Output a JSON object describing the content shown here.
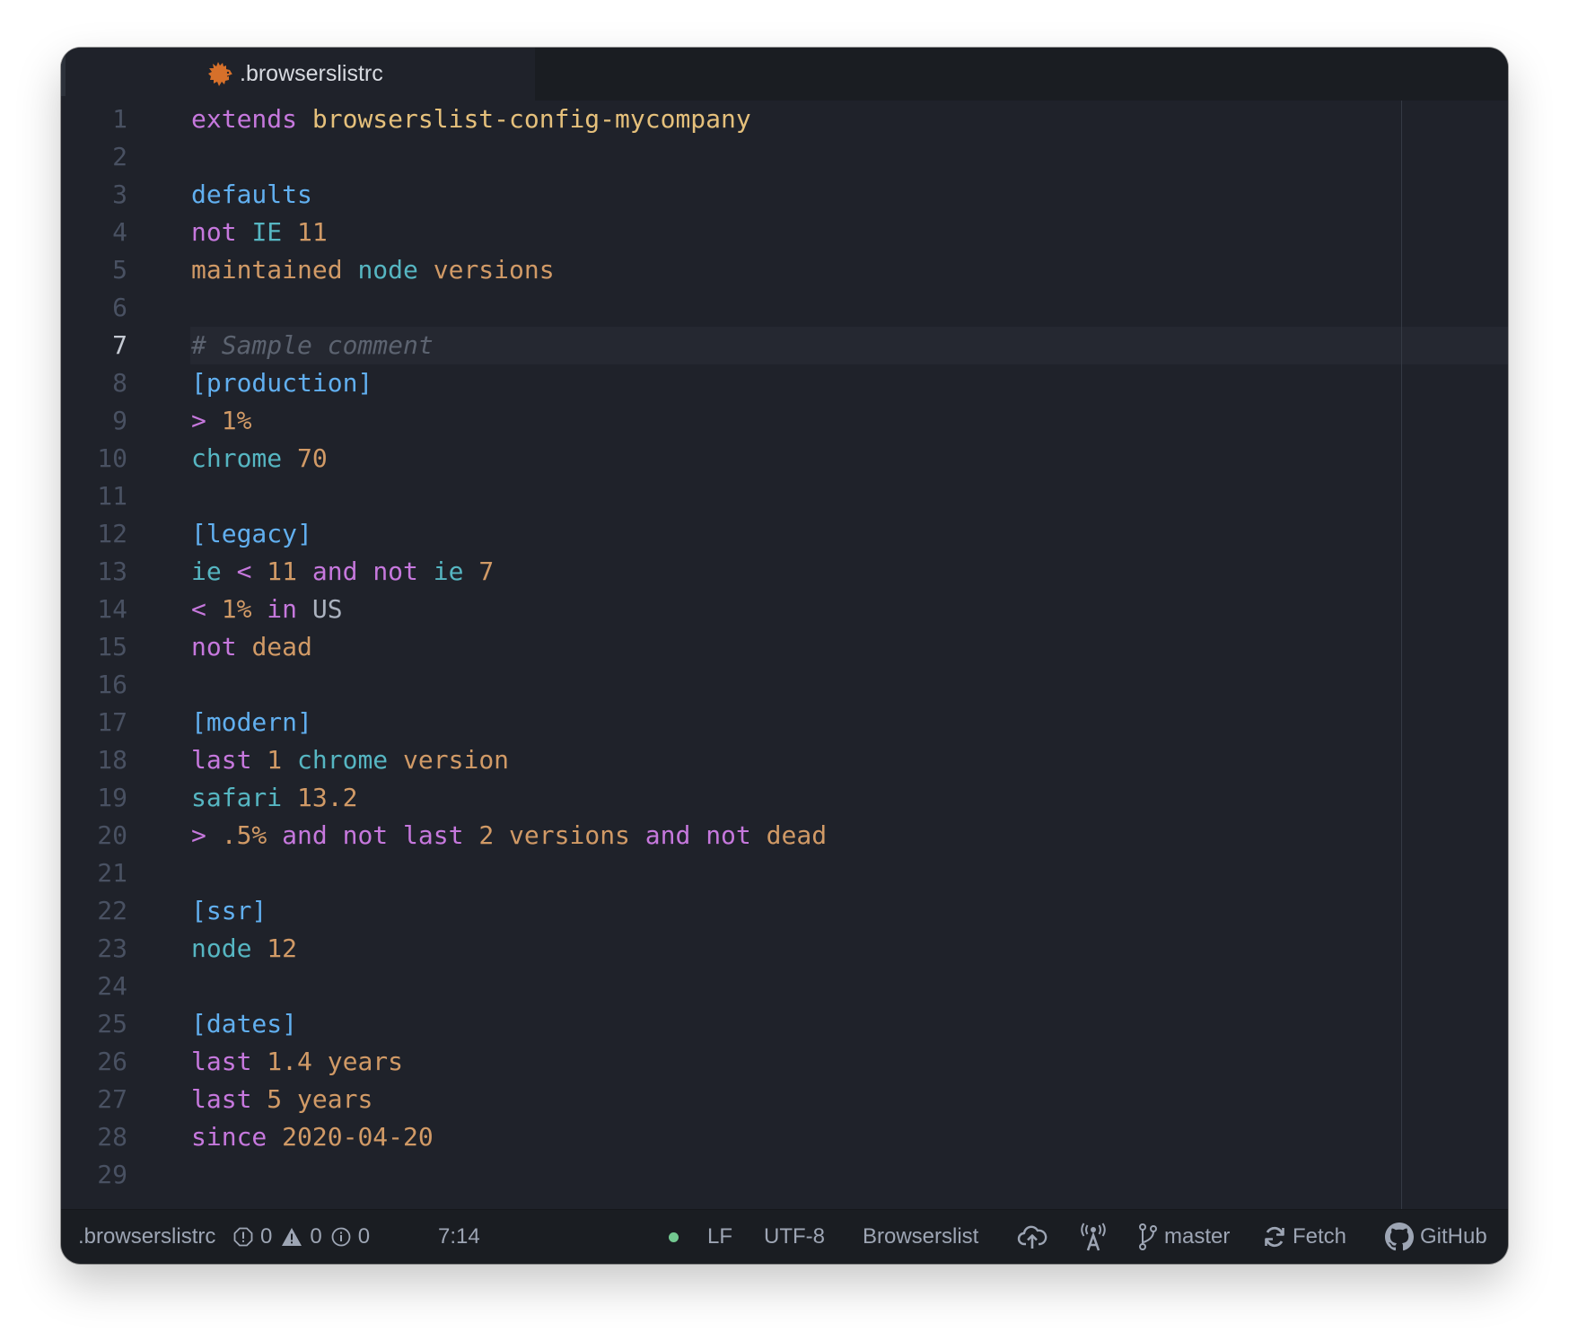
{
  "tab": {
    "label": ".browserslistrc",
    "icon": "browserslist-hedgehog-icon",
    "icon_color": "#d6702a"
  },
  "editor": {
    "cursor_line": 7,
    "lines": [
      {
        "n": "1",
        "tokens": [
          [
            "keyword",
            "extends"
          ],
          [
            "plain",
            " "
          ],
          [
            "string",
            "browserslist-config-mycompany"
          ]
        ]
      },
      {
        "n": "2",
        "tokens": []
      },
      {
        "n": "3",
        "tokens": [
          [
            "section",
            "defaults"
          ]
        ]
      },
      {
        "n": "4",
        "tokens": [
          [
            "keyword",
            "not"
          ],
          [
            "plain",
            " "
          ],
          [
            "browser",
            "IE"
          ],
          [
            "plain",
            " "
          ],
          [
            "number",
            "11"
          ]
        ]
      },
      {
        "n": "5",
        "tokens": [
          [
            "number",
            "maintained"
          ],
          [
            "plain",
            " "
          ],
          [
            "browser",
            "node"
          ],
          [
            "plain",
            " "
          ],
          [
            "number",
            "versions"
          ]
        ]
      },
      {
        "n": "6",
        "tokens": []
      },
      {
        "n": "7",
        "tokens": [
          [
            "comment",
            "# Sample comment"
          ]
        ]
      },
      {
        "n": "8",
        "tokens": [
          [
            "section",
            "[production]"
          ]
        ]
      },
      {
        "n": "9",
        "tokens": [
          [
            "keyword",
            ">"
          ],
          [
            "plain",
            " "
          ],
          [
            "number",
            "1%"
          ]
        ]
      },
      {
        "n": "10",
        "tokens": [
          [
            "browser",
            "chrome"
          ],
          [
            "plain",
            " "
          ],
          [
            "number",
            "70"
          ]
        ]
      },
      {
        "n": "11",
        "tokens": []
      },
      {
        "n": "12",
        "tokens": [
          [
            "section",
            "[legacy]"
          ]
        ]
      },
      {
        "n": "13",
        "tokens": [
          [
            "browser",
            "ie"
          ],
          [
            "plain",
            " "
          ],
          [
            "keyword",
            "<"
          ],
          [
            "plain",
            " "
          ],
          [
            "number",
            "11"
          ],
          [
            "plain",
            " "
          ],
          [
            "keyword",
            "and"
          ],
          [
            "plain",
            " "
          ],
          [
            "keyword",
            "not"
          ],
          [
            "plain",
            " "
          ],
          [
            "browser",
            "ie"
          ],
          [
            "plain",
            " "
          ],
          [
            "number",
            "7"
          ]
        ]
      },
      {
        "n": "14",
        "tokens": [
          [
            "keyword",
            "<"
          ],
          [
            "plain",
            " "
          ],
          [
            "number",
            "1%"
          ],
          [
            "plain",
            " "
          ],
          [
            "keyword",
            "in"
          ],
          [
            "plain",
            " "
          ],
          [
            "plain",
            "US"
          ]
        ]
      },
      {
        "n": "15",
        "tokens": [
          [
            "keyword",
            "not"
          ],
          [
            "plain",
            " "
          ],
          [
            "number",
            "dead"
          ]
        ]
      },
      {
        "n": "16",
        "tokens": []
      },
      {
        "n": "17",
        "tokens": [
          [
            "section",
            "[modern]"
          ]
        ]
      },
      {
        "n": "18",
        "tokens": [
          [
            "keyword",
            "last"
          ],
          [
            "plain",
            " "
          ],
          [
            "number",
            "1"
          ],
          [
            "plain",
            " "
          ],
          [
            "browser",
            "chrome"
          ],
          [
            "plain",
            " "
          ],
          [
            "number",
            "version"
          ]
        ]
      },
      {
        "n": "19",
        "tokens": [
          [
            "browser",
            "safari"
          ],
          [
            "plain",
            " "
          ],
          [
            "number",
            "13.2"
          ]
        ]
      },
      {
        "n": "20",
        "tokens": [
          [
            "keyword",
            ">"
          ],
          [
            "plain",
            " "
          ],
          [
            "number",
            ".5%"
          ],
          [
            "plain",
            " "
          ],
          [
            "keyword",
            "and"
          ],
          [
            "plain",
            " "
          ],
          [
            "keyword",
            "not"
          ],
          [
            "plain",
            " "
          ],
          [
            "keyword",
            "last"
          ],
          [
            "plain",
            " "
          ],
          [
            "number",
            "2"
          ],
          [
            "plain",
            " "
          ],
          [
            "number",
            "versions"
          ],
          [
            "plain",
            " "
          ],
          [
            "keyword",
            "and"
          ],
          [
            "plain",
            " "
          ],
          [
            "keyword",
            "not"
          ],
          [
            "plain",
            " "
          ],
          [
            "number",
            "dead"
          ]
        ]
      },
      {
        "n": "21",
        "tokens": []
      },
      {
        "n": "22",
        "tokens": [
          [
            "section",
            "[ssr]"
          ]
        ]
      },
      {
        "n": "23",
        "tokens": [
          [
            "browser",
            "node"
          ],
          [
            "plain",
            " "
          ],
          [
            "number",
            "12"
          ]
        ]
      },
      {
        "n": "24",
        "tokens": []
      },
      {
        "n": "25",
        "tokens": [
          [
            "section",
            "[dates]"
          ]
        ]
      },
      {
        "n": "26",
        "tokens": [
          [
            "keyword",
            "last"
          ],
          [
            "plain",
            " "
          ],
          [
            "number",
            "1.4"
          ],
          [
            "plain",
            " "
          ],
          [
            "number",
            "years"
          ]
        ]
      },
      {
        "n": "27",
        "tokens": [
          [
            "keyword",
            "last"
          ],
          [
            "plain",
            " "
          ],
          [
            "number",
            "5"
          ],
          [
            "plain",
            " "
          ],
          [
            "number",
            "years"
          ]
        ]
      },
      {
        "n": "28",
        "tokens": [
          [
            "keyword",
            "since"
          ],
          [
            "plain",
            " "
          ],
          [
            "number",
            "2020-04-20"
          ]
        ]
      },
      {
        "n": "29",
        "tokens": []
      }
    ]
  },
  "statusbar": {
    "file_name": ".browserslistrc",
    "errors": "0",
    "warnings": "0",
    "infos": "0",
    "cursor_position": "7:14",
    "line_ending": "LF",
    "encoding": "UTF-8",
    "grammar": "Browserslist",
    "branch": "master",
    "fetch_label": "Fetch",
    "github_label": "GitHub",
    "status_dot_color": "#73c991"
  }
}
